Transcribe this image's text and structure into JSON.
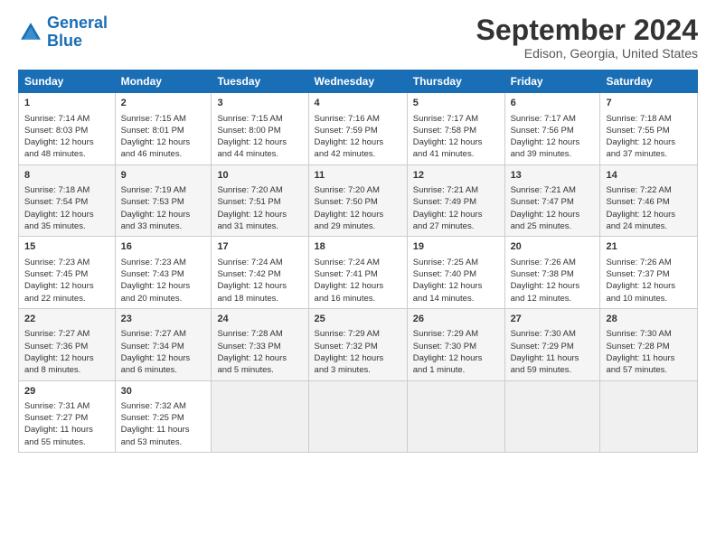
{
  "header": {
    "logo_line1": "General",
    "logo_line2": "Blue",
    "title": "September 2024",
    "subtitle": "Edison, Georgia, United States"
  },
  "columns": [
    "Sunday",
    "Monday",
    "Tuesday",
    "Wednesday",
    "Thursday",
    "Friday",
    "Saturday"
  ],
  "weeks": [
    [
      {
        "day": "1",
        "lines": [
          "Sunrise: 7:14 AM",
          "Sunset: 8:03 PM",
          "Daylight: 12 hours",
          "and 48 minutes."
        ]
      },
      {
        "day": "2",
        "lines": [
          "Sunrise: 7:15 AM",
          "Sunset: 8:01 PM",
          "Daylight: 12 hours",
          "and 46 minutes."
        ]
      },
      {
        "day": "3",
        "lines": [
          "Sunrise: 7:15 AM",
          "Sunset: 8:00 PM",
          "Daylight: 12 hours",
          "and 44 minutes."
        ]
      },
      {
        "day": "4",
        "lines": [
          "Sunrise: 7:16 AM",
          "Sunset: 7:59 PM",
          "Daylight: 12 hours",
          "and 42 minutes."
        ]
      },
      {
        "day": "5",
        "lines": [
          "Sunrise: 7:17 AM",
          "Sunset: 7:58 PM",
          "Daylight: 12 hours",
          "and 41 minutes."
        ]
      },
      {
        "day": "6",
        "lines": [
          "Sunrise: 7:17 AM",
          "Sunset: 7:56 PM",
          "Daylight: 12 hours",
          "and 39 minutes."
        ]
      },
      {
        "day": "7",
        "lines": [
          "Sunrise: 7:18 AM",
          "Sunset: 7:55 PM",
          "Daylight: 12 hours",
          "and 37 minutes."
        ]
      }
    ],
    [
      {
        "day": "8",
        "lines": [
          "Sunrise: 7:18 AM",
          "Sunset: 7:54 PM",
          "Daylight: 12 hours",
          "and 35 minutes."
        ]
      },
      {
        "day": "9",
        "lines": [
          "Sunrise: 7:19 AM",
          "Sunset: 7:53 PM",
          "Daylight: 12 hours",
          "and 33 minutes."
        ]
      },
      {
        "day": "10",
        "lines": [
          "Sunrise: 7:20 AM",
          "Sunset: 7:51 PM",
          "Daylight: 12 hours",
          "and 31 minutes."
        ]
      },
      {
        "day": "11",
        "lines": [
          "Sunrise: 7:20 AM",
          "Sunset: 7:50 PM",
          "Daylight: 12 hours",
          "and 29 minutes."
        ]
      },
      {
        "day": "12",
        "lines": [
          "Sunrise: 7:21 AM",
          "Sunset: 7:49 PM",
          "Daylight: 12 hours",
          "and 27 minutes."
        ]
      },
      {
        "day": "13",
        "lines": [
          "Sunrise: 7:21 AM",
          "Sunset: 7:47 PM",
          "Daylight: 12 hours",
          "and 25 minutes."
        ]
      },
      {
        "day": "14",
        "lines": [
          "Sunrise: 7:22 AM",
          "Sunset: 7:46 PM",
          "Daylight: 12 hours",
          "and 24 minutes."
        ]
      }
    ],
    [
      {
        "day": "15",
        "lines": [
          "Sunrise: 7:23 AM",
          "Sunset: 7:45 PM",
          "Daylight: 12 hours",
          "and 22 minutes."
        ]
      },
      {
        "day": "16",
        "lines": [
          "Sunrise: 7:23 AM",
          "Sunset: 7:43 PM",
          "Daylight: 12 hours",
          "and 20 minutes."
        ]
      },
      {
        "day": "17",
        "lines": [
          "Sunrise: 7:24 AM",
          "Sunset: 7:42 PM",
          "Daylight: 12 hours",
          "and 18 minutes."
        ]
      },
      {
        "day": "18",
        "lines": [
          "Sunrise: 7:24 AM",
          "Sunset: 7:41 PM",
          "Daylight: 12 hours",
          "and 16 minutes."
        ]
      },
      {
        "day": "19",
        "lines": [
          "Sunrise: 7:25 AM",
          "Sunset: 7:40 PM",
          "Daylight: 12 hours",
          "and 14 minutes."
        ]
      },
      {
        "day": "20",
        "lines": [
          "Sunrise: 7:26 AM",
          "Sunset: 7:38 PM",
          "Daylight: 12 hours",
          "and 12 minutes."
        ]
      },
      {
        "day": "21",
        "lines": [
          "Sunrise: 7:26 AM",
          "Sunset: 7:37 PM",
          "Daylight: 12 hours",
          "and 10 minutes."
        ]
      }
    ],
    [
      {
        "day": "22",
        "lines": [
          "Sunrise: 7:27 AM",
          "Sunset: 7:36 PM",
          "Daylight: 12 hours",
          "and 8 minutes."
        ]
      },
      {
        "day": "23",
        "lines": [
          "Sunrise: 7:27 AM",
          "Sunset: 7:34 PM",
          "Daylight: 12 hours",
          "and 6 minutes."
        ]
      },
      {
        "day": "24",
        "lines": [
          "Sunrise: 7:28 AM",
          "Sunset: 7:33 PM",
          "Daylight: 12 hours",
          "and 5 minutes."
        ]
      },
      {
        "day": "25",
        "lines": [
          "Sunrise: 7:29 AM",
          "Sunset: 7:32 PM",
          "Daylight: 12 hours",
          "and 3 minutes."
        ]
      },
      {
        "day": "26",
        "lines": [
          "Sunrise: 7:29 AM",
          "Sunset: 7:30 PM",
          "Daylight: 12 hours",
          "and 1 minute."
        ]
      },
      {
        "day": "27",
        "lines": [
          "Sunrise: 7:30 AM",
          "Sunset: 7:29 PM",
          "Daylight: 11 hours",
          "and 59 minutes."
        ]
      },
      {
        "day": "28",
        "lines": [
          "Sunrise: 7:30 AM",
          "Sunset: 7:28 PM",
          "Daylight: 11 hours",
          "and 57 minutes."
        ]
      }
    ],
    [
      {
        "day": "29",
        "lines": [
          "Sunrise: 7:31 AM",
          "Sunset: 7:27 PM",
          "Daylight: 11 hours",
          "and 55 minutes."
        ]
      },
      {
        "day": "30",
        "lines": [
          "Sunrise: 7:32 AM",
          "Sunset: 7:25 PM",
          "Daylight: 11 hours",
          "and 53 minutes."
        ]
      },
      {
        "day": "",
        "lines": []
      },
      {
        "day": "",
        "lines": []
      },
      {
        "day": "",
        "lines": []
      },
      {
        "day": "",
        "lines": []
      },
      {
        "day": "",
        "lines": []
      }
    ]
  ]
}
